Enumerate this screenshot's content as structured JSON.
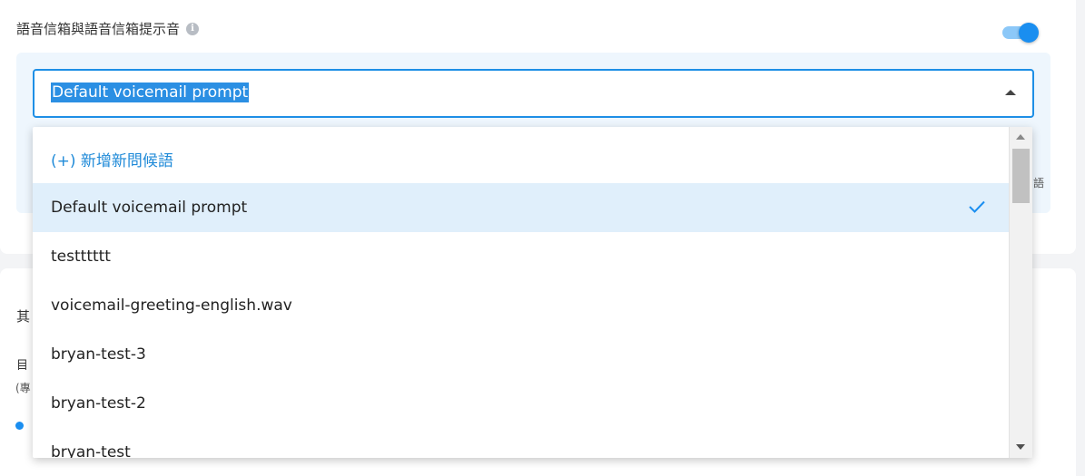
{
  "section": {
    "title": "語音信箱與語音信箱提示音",
    "info_icon": "info-icon",
    "toggle_on": true
  },
  "select": {
    "value": "Default voicemail prompt",
    "caret_icon": "caret-up-icon"
  },
  "background": {
    "bottom_title_fragment": "其",
    "bottom_label_fragment": "目",
    "bottom_note_fragment": "(專",
    "right_fragment": "語"
  },
  "dropdown": {
    "options": [
      {
        "label": "(+) 新增新問候語",
        "type": "add-new",
        "selected": false
      },
      {
        "label": "Default voicemail prompt",
        "type": "option",
        "selected": true
      },
      {
        "label": "testttttt",
        "type": "option",
        "selected": false
      },
      {
        "label": "voicemail-greeting-english.wav",
        "type": "option",
        "selected": false
      },
      {
        "label": "bryan-test-3",
        "type": "option",
        "selected": false
      },
      {
        "label": "bryan-test-2",
        "type": "option",
        "selected": false
      },
      {
        "label": "bryan-test",
        "type": "option",
        "selected": false
      }
    ],
    "check_icon": "check-icon"
  },
  "colors": {
    "accent": "#1a8ef0",
    "add_new_text": "#1f8ad8",
    "selected_row": "#e0effb",
    "panel_bg": "#eef6fd"
  }
}
